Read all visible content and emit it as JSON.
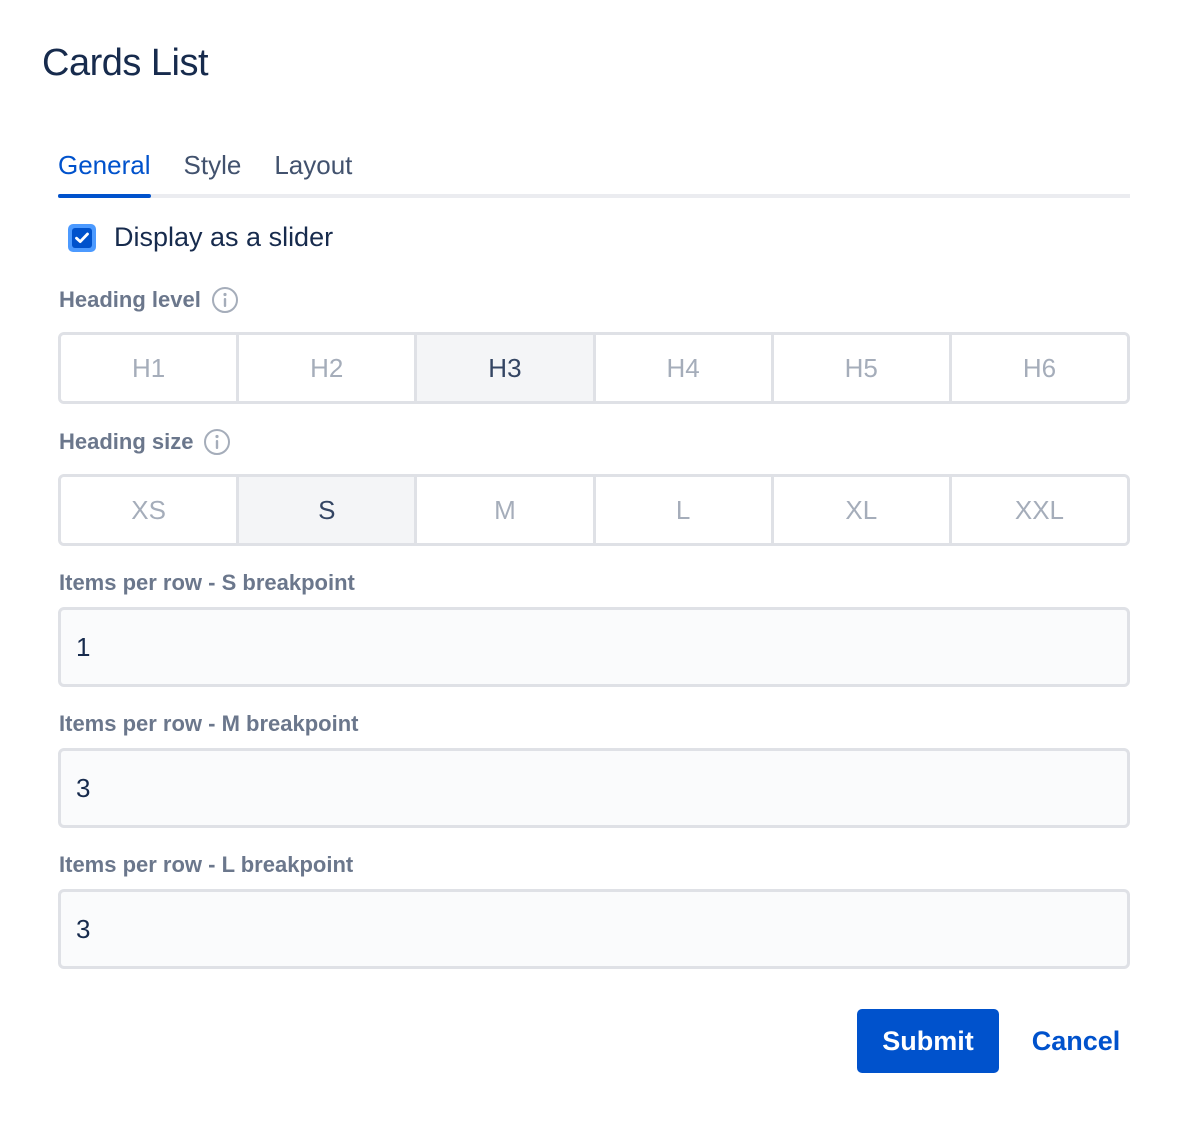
{
  "dialog": {
    "title": "Cards List"
  },
  "tabs": [
    {
      "label": "General",
      "active": true
    },
    {
      "label": "Style",
      "active": false
    },
    {
      "label": "Layout",
      "active": false
    }
  ],
  "display_as_slider": {
    "label": "Display as a slider",
    "checked": true
  },
  "heading_level": {
    "label": "Heading level",
    "info_icon": "info-icon",
    "options": [
      "H1",
      "H2",
      "H3",
      "H4",
      "H5",
      "H6"
    ],
    "selected": "H3"
  },
  "heading_size": {
    "label": "Heading size",
    "info_icon": "info-icon",
    "options": [
      "XS",
      "S",
      "M",
      "L",
      "XL",
      "XXL"
    ],
    "selected": "S"
  },
  "items_per_row_s": {
    "label": "Items per row - S breakpoint",
    "value": "1"
  },
  "items_per_row_m": {
    "label": "Items per row - M breakpoint",
    "value": "3"
  },
  "items_per_row_l": {
    "label": "Items per row - L breakpoint",
    "value": "3"
  },
  "actions": {
    "submit_label": "Submit",
    "cancel_label": "Cancel"
  },
  "colors": {
    "accent": "#0052cc",
    "text": "#172b4d",
    "muted": "#6b778c",
    "border": "#dfe1e6"
  }
}
